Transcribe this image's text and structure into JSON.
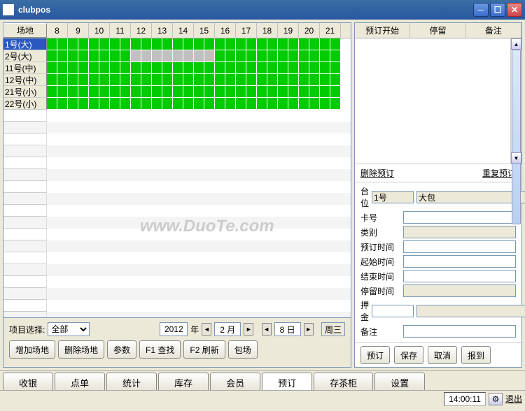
{
  "window": {
    "title": "clubpos"
  },
  "grid": {
    "header_first": "场地",
    "hours": [
      "8",
      "9",
      "10",
      "11",
      "12",
      "13",
      "14",
      "15",
      "16",
      "17",
      "18",
      "19",
      "20",
      "21"
    ],
    "rows": [
      {
        "name": "1号(大)",
        "selected": true,
        "slots": "ffffffffffffffffffffffffffff"
      },
      {
        "name": "2号(大)",
        "selected": false,
        "slots": "ffffffffbbbbbbbbffffffffffff"
      },
      {
        "name": "11号(中)",
        "selected": false,
        "slots": "ffffffffffffffffffffffffffff"
      },
      {
        "name": "12号(中)",
        "selected": false,
        "slots": "ffffffffffffffffffffffffffff"
      },
      {
        "name": "21号(小)",
        "selected": false,
        "slots": "ffffffffffffffffffffffffffff"
      },
      {
        "name": "22号(小)",
        "selected": false,
        "slots": "ffffffffffffffffffffffffffff"
      }
    ]
  },
  "rightPanel": {
    "headers": [
      "预订开始",
      "停留",
      "备注"
    ],
    "delete_link": "删除预订",
    "repeat_link": "重复预订"
  },
  "form": {
    "labels": {
      "seat": "台位",
      "card": "卡号",
      "type": "类别",
      "book_time": "预订时间",
      "start_time": "起始时间",
      "end_time": "结束时间",
      "stay_time": "停留时间",
      "deposit": "押金",
      "remark": "备注"
    },
    "seat_value": "1号",
    "seat_type": "大包"
  },
  "rightButtons": {
    "book": "预订",
    "save": "保存",
    "cancel": "取消",
    "report": "报到"
  },
  "leftControls": {
    "project_label": "项目选择:",
    "project_value": "全部",
    "year": "2012",
    "year_suffix": "年",
    "month": "2 月",
    "day": "8 日",
    "weekday": "周三"
  },
  "leftButtons": {
    "add_venue": "增加场地",
    "del_venue": "删除场地",
    "params": "参数",
    "find": "F1 查找",
    "refresh": "F2 刷新",
    "baochang": "包场"
  },
  "tabs": [
    "收银",
    "点单",
    "统计",
    "库存",
    "会员",
    "预订",
    "存茶柜",
    "设置"
  ],
  "active_tab": 5,
  "status": {
    "time": "14:00:11",
    "exit": "退出"
  },
  "watermark": "www.DuoTe.com"
}
